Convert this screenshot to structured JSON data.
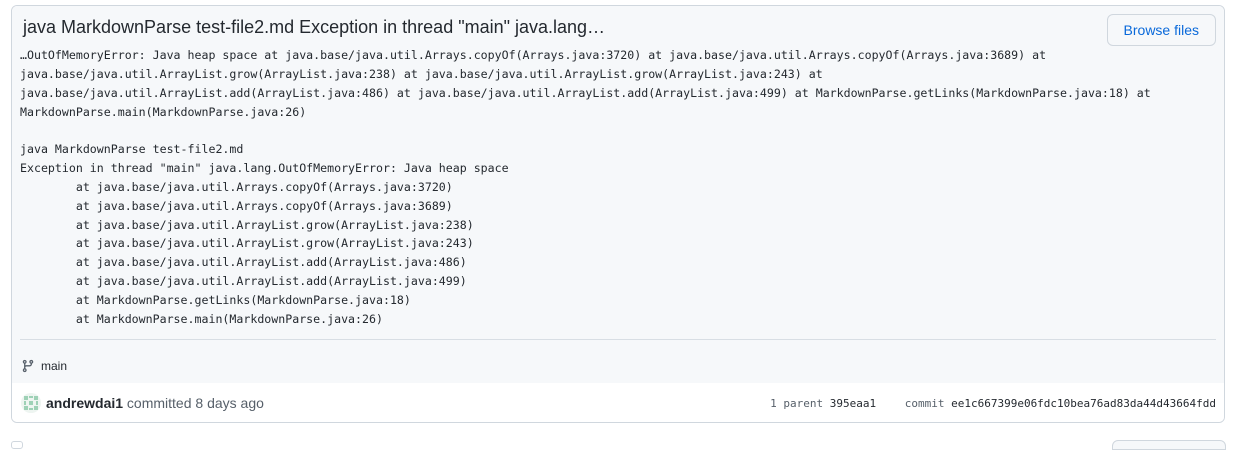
{
  "commit": {
    "title": "java MarkdownParse test-file2.md Exception in thread \"main\" java.lang…",
    "browse_label": "Browse files",
    "description": "…OutOfMemoryError: Java heap space at java.base/java.util.Arrays.copyOf(Arrays.java:3720) at java.base/java.util.Arrays.copyOf(Arrays.java:3689) at\njava.base/java.util.ArrayList.grow(ArrayList.java:238) at java.base/java.util.ArrayList.grow(ArrayList.java:243) at\njava.base/java.util.ArrayList.add(ArrayList.java:486) at java.base/java.util.ArrayList.add(ArrayList.java:499) at MarkdownParse.getLinks(MarkdownParse.java:18) at\nMarkdownParse.main(MarkdownParse.java:26)\n\njava MarkdownParse test-file2.md\nException in thread \"main\" java.lang.OutOfMemoryError: Java heap space\n        at java.base/java.util.Arrays.copyOf(Arrays.java:3720)\n        at java.base/java.util.Arrays.copyOf(Arrays.java:3689)\n        at java.base/java.util.ArrayList.grow(ArrayList.java:238)\n        at java.base/java.util.ArrayList.grow(ArrayList.java:243)\n        at java.base/java.util.ArrayList.add(ArrayList.java:486)\n        at java.base/java.util.ArrayList.add(ArrayList.java:499)\n        at MarkdownParse.getLinks(MarkdownParse.java:18)\n        at MarkdownParse.main(MarkdownParse.java:26)",
    "branch": "main",
    "author": "andrewdai1",
    "action": "committed",
    "time": "8 days ago",
    "parent_count_label": "1 parent",
    "parent_sha": "395eaa1",
    "commit_label": "commit",
    "commit_sha": "ee1c667399e06fdc10bea76ad83da44d43664fdd"
  },
  "icons": {
    "branch": "git-branch-icon",
    "avatar": "identicon-avatar"
  },
  "colors": {
    "link": "#0969da",
    "border": "#d0d7de",
    "header_bg": "#f6f8fa",
    "text": "#24292f",
    "muted": "#57606a",
    "avatar": "#9ed1b6"
  }
}
